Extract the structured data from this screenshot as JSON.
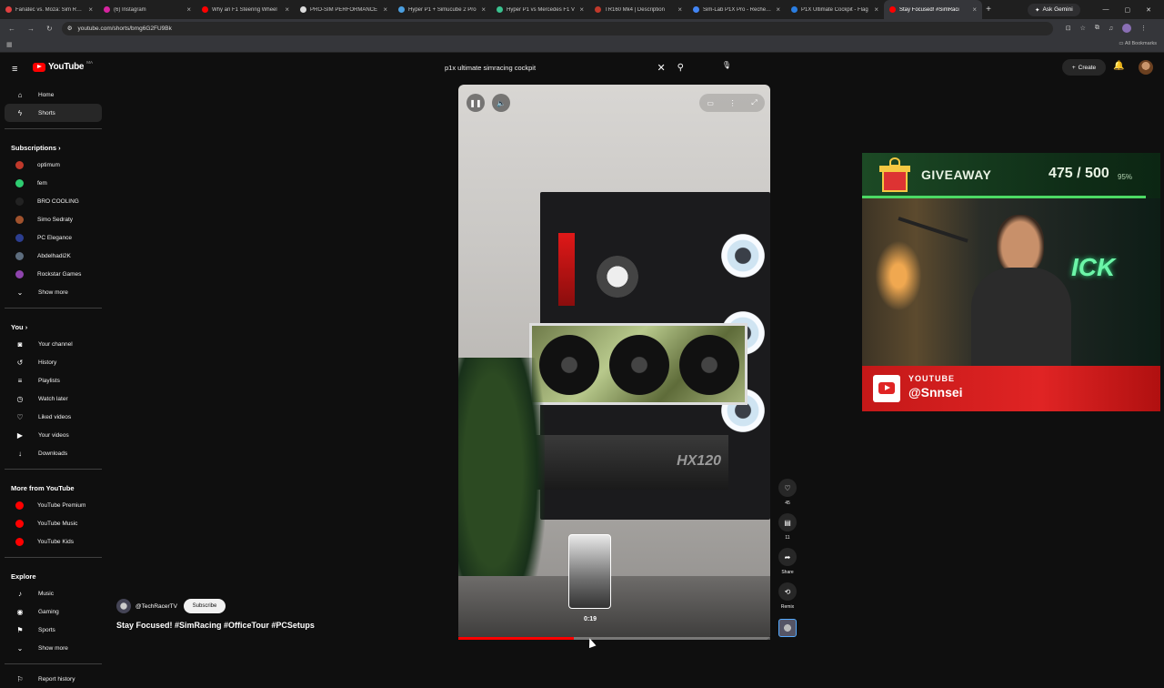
{
  "browser": {
    "tabs": [
      {
        "title": "Fanatec vs. Moza: Sim Racin",
        "color": "#e04040"
      },
      {
        "title": "(6) Instagram",
        "color": "#d6249f"
      },
      {
        "title": "Why an F1 Steering Wheel",
        "color": "#ff0000"
      },
      {
        "title": "PRO-SIM PERFORMANCE",
        "color": "#dddddd"
      },
      {
        "title": "Hyper P1 + Simucube 2 Pro",
        "color": "#4b9fe0"
      },
      {
        "title": "Hyper P1 vs Mercedes F1 V",
        "color": "#3ac28f"
      },
      {
        "title": "TR160 Mk4 | Description",
        "color": "#c0392b"
      },
      {
        "title": "Sim-Lab P1X Pro - Recherch",
        "color": "#4285f4"
      },
      {
        "title": "P1X Ultimate Cockpit - Flag",
        "color": "#2a7de1"
      },
      {
        "title": "Stay Focused! #SimRaci",
        "color": "#ff0000"
      }
    ],
    "ask_gemini": "Ask Gemini",
    "url": "youtube.com/shorts/bmg6G2FU9Bk",
    "all_bookmarks": "All Bookmarks"
  },
  "header": {
    "logo_text": "YouTube",
    "country_code": "MA",
    "search_query": "p1x ultimate simracing cockpit",
    "create_label": "Create"
  },
  "sidebar": {
    "main": [
      {
        "label": "Home",
        "icon": "home-icon",
        "glyph": "⌂"
      },
      {
        "label": "Shorts",
        "icon": "shorts-icon",
        "glyph": "ϟ"
      }
    ],
    "subscriptions_title": "Subscriptions",
    "subscriptions": [
      {
        "label": "optimum",
        "color": "#c0392b"
      },
      {
        "label": "fem",
        "color": "#2ecc71"
      },
      {
        "label": "BRO COOLING",
        "color": "#222222"
      },
      {
        "label": "Simo Sedraty",
        "color": "#a0522d"
      },
      {
        "label": "PC Elegance",
        "color": "#2c3e90"
      },
      {
        "label": "Abdelhadi2K",
        "color": "#5d6d7e"
      },
      {
        "label": "Rockstar Games",
        "color": "#8e44ad"
      }
    ],
    "show_more": "Show more",
    "you_title": "You",
    "you_items": [
      {
        "label": "Your channel",
        "glyph": "◙"
      },
      {
        "label": "History",
        "glyph": "↺"
      },
      {
        "label": "Playlists",
        "glyph": "≡"
      },
      {
        "label": "Watch later",
        "glyph": "◷"
      },
      {
        "label": "Liked videos",
        "glyph": "♡"
      },
      {
        "label": "Your videos",
        "glyph": "▶"
      },
      {
        "label": "Downloads",
        "glyph": "↓"
      }
    ],
    "more_title": "More from YouTube",
    "more_items": [
      {
        "label": "YouTube Premium",
        "color": "#ff0000"
      },
      {
        "label": "YouTube Music",
        "color": "#ff0000"
      },
      {
        "label": "YouTube Kids",
        "color": "#ff0000"
      }
    ],
    "explore_title": "Explore",
    "explore_items": [
      {
        "label": "Music",
        "glyph": "♪"
      },
      {
        "label": "Gaming",
        "glyph": "◉"
      },
      {
        "label": "Sports",
        "glyph": "⚑"
      }
    ],
    "explore_show_more": "Show more",
    "report_history": "Report history"
  },
  "player": {
    "psu_label": "HX120",
    "hover_time": "0:19",
    "progress": 0.37
  },
  "actions": {
    "likes": "45",
    "comments": "11",
    "share": "Share",
    "remix": "Remix"
  },
  "meta": {
    "channel": "@TechRacerTV",
    "subscribe": "Subscribe",
    "title": "Stay Focused! #SimRacing #OfficeTour #PCSetups"
  },
  "overlay": {
    "giveaway": "GIVEAWAY",
    "count_current": "475",
    "count_total": "500",
    "percent": "95%",
    "progress": 0.95,
    "neon": "ICK",
    "youtube_label": "YOUTUBE",
    "handle": "@Snnsei"
  }
}
